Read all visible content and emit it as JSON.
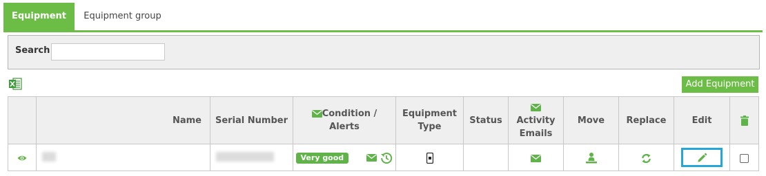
{
  "tabs": [
    {
      "label": "Equipment",
      "active": true
    },
    {
      "label": "Equipment group",
      "active": false
    }
  ],
  "search": {
    "label": "Search",
    "value": "",
    "placeholder": ""
  },
  "toolbar": {
    "add_button_label": "Add Equipment",
    "export_icon": "excel-icon"
  },
  "table": {
    "headers": {
      "name": "Name",
      "serial": "Serial Number",
      "condition": "Condition / Alerts",
      "equipment_type": "Equipment Type",
      "status": "Status",
      "activity": "Activity Emails",
      "move": "Move",
      "replace": "Replace",
      "edit": "Edit"
    },
    "rows": [
      {
        "name": "",
        "serial": "",
        "condition": "Very good",
        "equipment_type_icon": "mobile-device-icon",
        "status": ""
      }
    ]
  },
  "colors": {
    "accent": "#6cbd45",
    "highlight": "#23a6d8",
    "header_bg": "#efefef"
  }
}
